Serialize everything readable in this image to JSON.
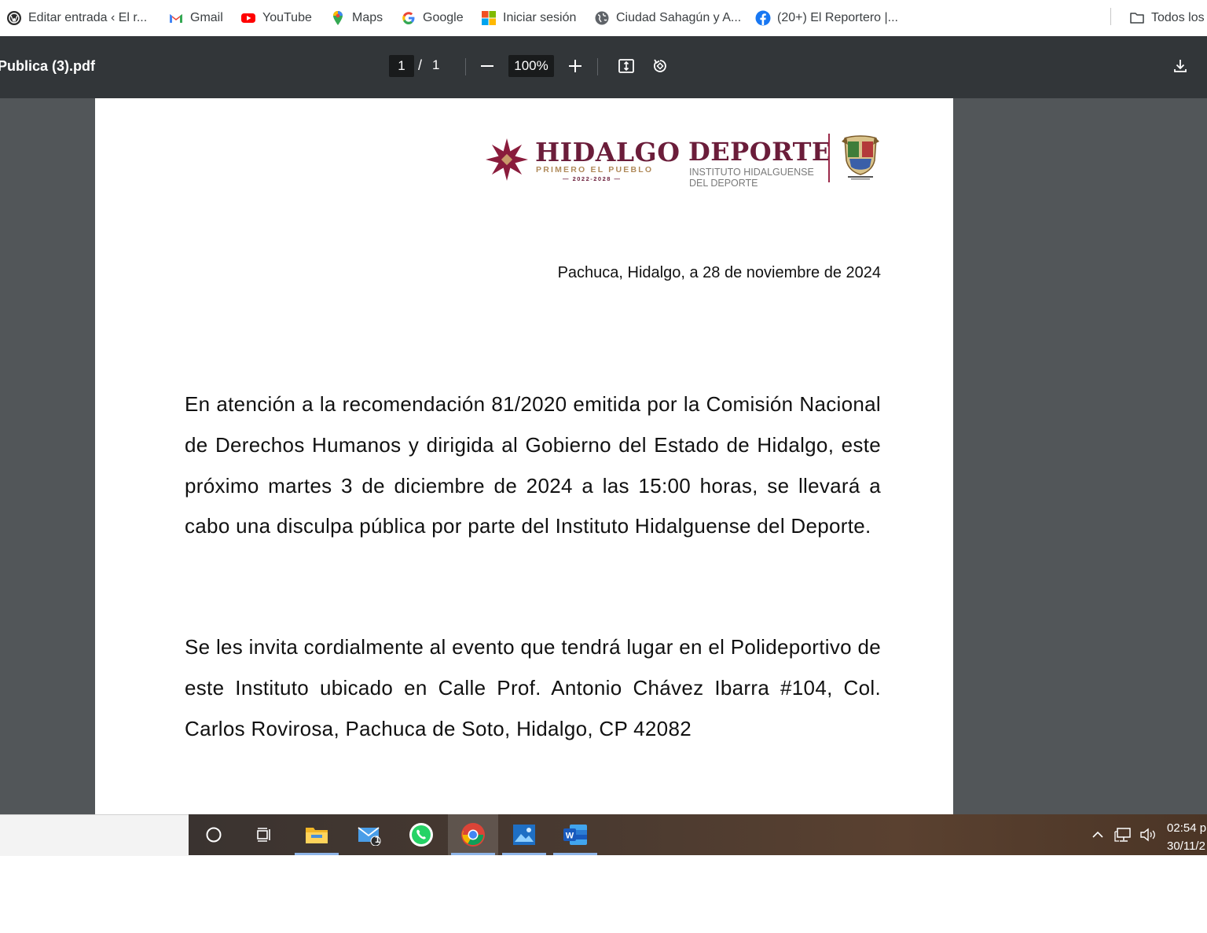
{
  "bookmarks": {
    "items": [
      {
        "label": "Editar entrada ‹ El r...",
        "icon": "wordpress-icon"
      },
      {
        "label": "Gmail",
        "icon": "gmail-icon"
      },
      {
        "label": "YouTube",
        "icon": "youtube-icon"
      },
      {
        "label": "Maps",
        "icon": "maps-pin-icon"
      },
      {
        "label": "Google",
        "icon": "google-icon"
      },
      {
        "label": "Iniciar sesión",
        "icon": "microsoft-icon"
      },
      {
        "label": "Ciudad Sahagún y A...",
        "icon": "globe-icon"
      },
      {
        "label": "(20+) El Reportero |...",
        "icon": "facebook-icon"
      }
    ],
    "all_bookmarks_label": "Todos los"
  },
  "pdf_toolbar": {
    "title": "Publica (3).pdf",
    "current_page": "1",
    "separator": "/",
    "total_pages": "1",
    "zoom": "100%"
  },
  "document": {
    "logo_hidalgo": "HIDALGO",
    "logo_hidalgo_tagline": "PRIMERO EL PUEBLO",
    "logo_hidalgo_years": "— 2022-2028 —",
    "logo_deporte": "DEPORTE",
    "logo_deporte_sub1": "INSTITUTO HIDALGUENSE",
    "logo_deporte_sub2": "DEL DEPORTE",
    "date_line": "Pachuca, Hidalgo, a 28 de noviembre de 2024",
    "paragraph1": "En atención a la recomendación 81/2020 emitida por la Comisión Nacional de Derechos Humanos y dirigida al Gobierno del Estado de Hidalgo, este próximo martes 3 de diciembre de 2024 a las 15:00 horas, se llevará a cabo una disculpa pública por parte del Instituto Hidalguense del Deporte.",
    "paragraph2": "Se les invita cordialmente al evento que tendrá lugar en el Polideportivo de este Instituto ubicado en Calle Prof. Antonio Chávez Ibarra #104, Col. Carlos Rovirosa, Pachuca de Soto, Hidalgo, CP 42082"
  },
  "taskbar": {
    "mail_badge": "1",
    "time": "02:54 p",
    "date": "30/11/2"
  },
  "colors": {
    "brand_guinda": "#6b1d3a",
    "brand_gold": "#b08a5a",
    "pdf_toolbar": "#323639",
    "viewer_bg": "#525659"
  }
}
